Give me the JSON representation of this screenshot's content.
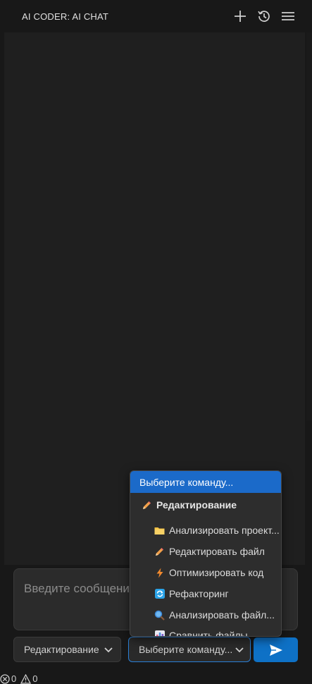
{
  "header": {
    "title": "AI CODER: AI CHAT",
    "actions": [
      {
        "name": "new-chat",
        "icon": "plus-icon"
      },
      {
        "name": "history",
        "icon": "history-icon"
      },
      {
        "name": "menu",
        "icon": "menu-icon"
      }
    ]
  },
  "input": {
    "placeholder": "Введите сообщение..."
  },
  "controls": {
    "mode_value": "Редактирование",
    "command_value": "Выберите команду...",
    "send_icon": "send-icon",
    "accent": "#0e71c6"
  },
  "dropdown": {
    "highlighted": "Выберите команду...",
    "group_label": "Редактирование",
    "group_icon": "pencil-icon",
    "options": [
      {
        "label": "Анализировать проект...",
        "icon": "folder-icon"
      },
      {
        "label": "Редактировать файл",
        "icon": "pencil-icon"
      },
      {
        "label": "Оптимизировать код",
        "icon": "lightning-icon"
      },
      {
        "label": "Рефакторинг",
        "icon": "refresh-icon"
      },
      {
        "label": "Анализировать файл...",
        "icon": "magnifier-icon"
      },
      {
        "label": "Сравнить файлы...",
        "icon": "chart-icon"
      }
    ]
  },
  "status": {
    "errors": "0",
    "warnings": "0"
  }
}
